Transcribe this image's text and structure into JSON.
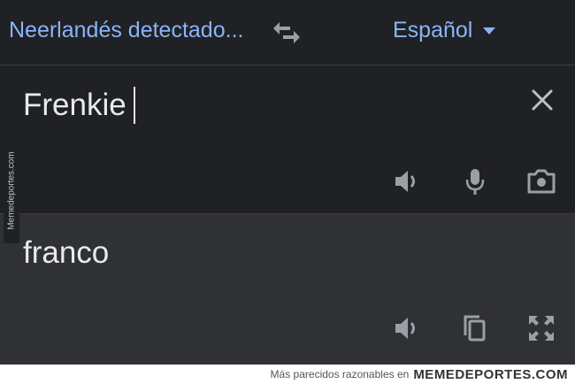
{
  "header": {
    "source_language": "Neerlandés detectado...",
    "target_language": "Español"
  },
  "input": {
    "text": "Frenkie"
  },
  "output": {
    "text": "franco"
  },
  "watermark": {
    "side_text": "Memedeportes.com",
    "footer_text": "Más parecidos razonables en",
    "footer_brand": "MEMEDEPORTES.COM"
  },
  "colors": {
    "accent": "#8ab4f8",
    "background": "#202124",
    "output_background": "#303134",
    "icon": "#9aa0a6"
  },
  "icons": [
    "swap-icon",
    "chevron-down-icon",
    "close-icon",
    "speaker-icon",
    "microphone-icon",
    "camera-icon",
    "copy-icon",
    "fullscreen-icon"
  ]
}
